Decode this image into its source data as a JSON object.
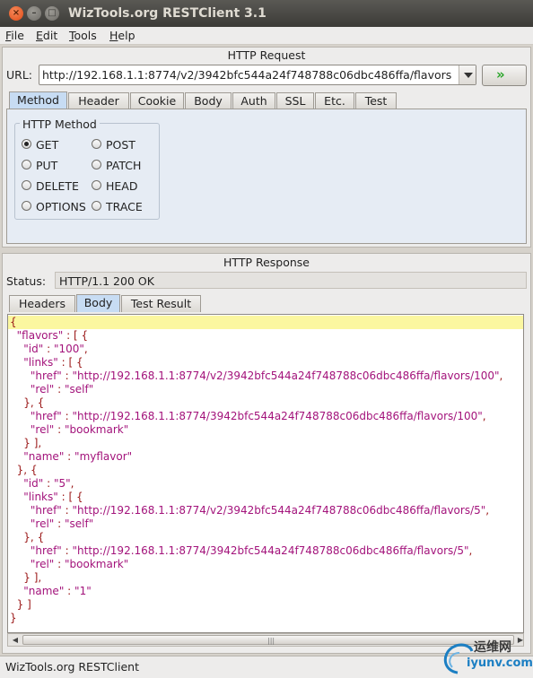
{
  "window": {
    "title": "WizTools.org RESTClient 3.1",
    "buttons": [
      {
        "name": "close",
        "glyph": "×"
      },
      {
        "name": "minimize",
        "glyph": "–"
      },
      {
        "name": "maximize",
        "glyph": "□"
      }
    ]
  },
  "menubar": [
    {
      "label": "File",
      "mnemonic": "F"
    },
    {
      "label": "Edit",
      "mnemonic": "E"
    },
    {
      "label": "Tools",
      "mnemonic": "T"
    },
    {
      "label": "Help",
      "mnemonic": "H"
    }
  ],
  "request": {
    "section_title": "HTTP Request",
    "url_label": "URL:",
    "url_value": "http://192.168.1.1:8774/v2/3942bfc544a24f748788c06dbc486ffa/flavors",
    "go_glyph": "»",
    "tabs": [
      "Method",
      "Header",
      "Cookie",
      "Body",
      "Auth",
      "SSL",
      "Etc.",
      "Test"
    ],
    "active_tab": "Method",
    "method_group_title": "HTTP Method",
    "methods": [
      {
        "label": "GET",
        "selected": true
      },
      {
        "label": "POST",
        "selected": false
      },
      {
        "label": "PUT",
        "selected": false
      },
      {
        "label": "PATCH",
        "selected": false
      },
      {
        "label": "DELETE",
        "selected": false
      },
      {
        "label": "HEAD",
        "selected": false
      },
      {
        "label": "OPTIONS",
        "selected": false
      },
      {
        "label": "TRACE",
        "selected": false
      }
    ]
  },
  "response": {
    "section_title": "HTTP Response",
    "status_label": "Status:",
    "status_value": "HTTP/1.1 200 OK",
    "tabs": [
      "Headers",
      "Body",
      "Test Result"
    ],
    "active_tab": "Body",
    "body_lines": [
      "{",
      "  \"flavors\" : [ {",
      "    \"id\" : \"100\",",
      "    \"links\" : [ {",
      "      \"href\" : \"http://192.168.1.1:8774/v2/3942bfc544a24f748788c06dbc486ffa/flavors/100\",",
      "      \"rel\" : \"self\"",
      "    }, {",
      "      \"href\" : \"http://192.168.1.1:8774/3942bfc544a24f748788c06dbc486ffa/flavors/100\",",
      "      \"rel\" : \"bookmark\"",
      "    } ],",
      "    \"name\" : \"myflavor\"",
      "  }, {",
      "    \"id\" : \"5\",",
      "    \"links\" : [ {",
      "      \"href\" : \"http://192.168.1.1:8774/v2/3942bfc544a24f748788c06dbc486ffa/flavors/5\",",
      "      \"rel\" : \"self\"",
      "    }, {",
      "      \"href\" : \"http://192.168.1.1:8774/3942bfc544a24f748788c06dbc486ffa/flavors/5\",",
      "      \"rel\" : \"bookmark\"",
      "    } ],",
      "    \"name\" : \"1\"",
      "  } ]",
      "}"
    ],
    "highlight_line": 0
  },
  "statusbar": {
    "text": "WizTools.org RESTClient"
  },
  "watermark": {
    "line1": "运维网",
    "line2": "iyunv.com"
  },
  "colors": {
    "accent_tab": "#c7dcf3",
    "json_string": "#a3137b",
    "json_punct": "#9a1616",
    "highlight": "#fbf7a0",
    "go_arrow": "#2aa52a"
  }
}
